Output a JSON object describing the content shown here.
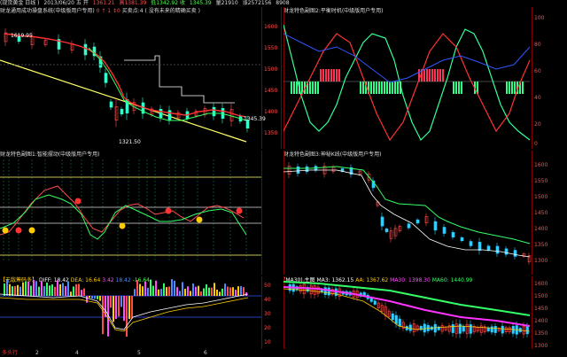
{
  "topbar": {
    "items": [
      "(现货黄金 日线 )",
      "2013/06/20 五 开",
      "1361.21",
      "高1381.39",
      "低1342.92 收",
      "1345.39",
      "量21910",
      "涨2572156",
      "8908"
    ]
  },
  "panels": {
    "p1": {
      "title": "财龙通用成功操盘系统(中级版用户专用)",
      "flags": "0 ↑ 1 ↕0",
      "extra": "买卖点:4 ( 没有未来的精确买卖 )",
      "label_high": "1619.95",
      "label_low": "1321.50",
      "label_right": "1345.39"
    },
    "p2": {
      "title": "财龙特色副图2:平衡时机(中级版用户专用)"
    },
    "p3": {
      "title": "财龙特色副图1:智能摆动(中级版用户专用)"
    },
    "p4": {
      "title": "财龙特色副图3:神秘K线(中级版用户专用)"
    },
    "p5": {
      "title": "【无敌筹码多】",
      "diff": "DIFF: 18.42",
      "dea": "DEA: 16.64",
      "v3": "3.42",
      "v4": "18.42",
      "v5": "-16.64"
    },
    "p6": {
      "title": "(MA30) 主图",
      "ma3": "MA3: 1362.15",
      "ma5": "AA: 1367.62",
      "ma10": "MA30: 1398.30",
      "ma60": "MA60: 1440.99"
    }
  },
  "axes": {
    "p1": [
      "1600",
      "1550",
      "1500",
      "1450",
      "1400",
      "1350"
    ],
    "p2": [
      "100",
      "80",
      "60",
      "40",
      "20",
      "0"
    ],
    "p3": [
      "-",
      "-",
      "-",
      "-",
      "-"
    ],
    "p4": [
      "1600",
      "1550",
      "1500",
      "1450",
      "1400",
      "1350",
      "1300"
    ],
    "p5": [
      "50",
      "40",
      "30",
      "20",
      "10"
    ],
    "p6": [
      "1600",
      "1500",
      "1450",
      "1400",
      "1350",
      "1300"
    ]
  },
  "bottombar": {
    "left": "多头行",
    "ticks": [
      "2",
      "4",
      "5",
      "6"
    ]
  }
}
